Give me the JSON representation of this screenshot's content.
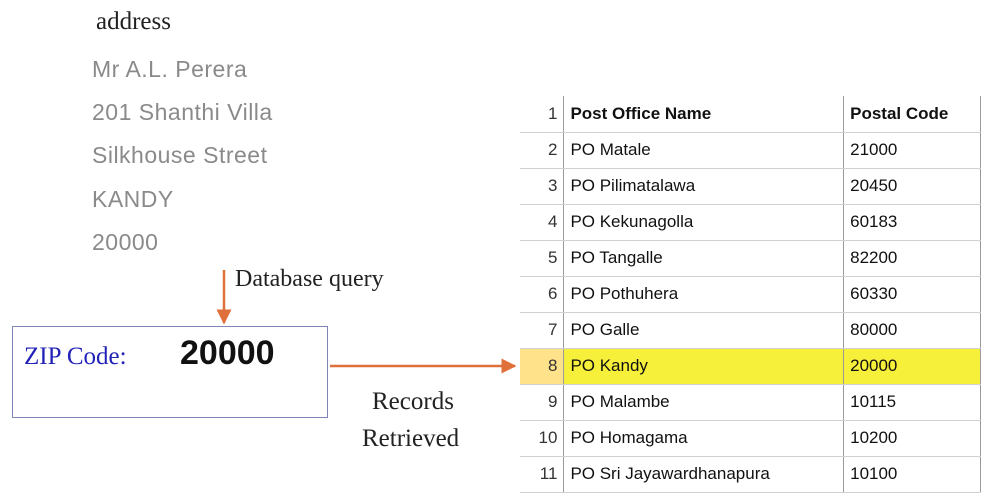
{
  "address": {
    "heading": "address",
    "lines": [
      "Mr A.L. Perera",
      "201 Shanthi Villa",
      "Silkhouse Street",
      "KANDY",
      "20000"
    ]
  },
  "query_label": "Database query",
  "zip": {
    "label": "ZIP Code:",
    "value": "20000"
  },
  "records_label": [
    "Records",
    "Retrieved"
  ],
  "table": {
    "rows": [
      {
        "num": "1",
        "name": "Post Office Name",
        "code": "Postal Code"
      },
      {
        "num": "2",
        "name": "PO Matale",
        "code": "21000"
      },
      {
        "num": "3",
        "name": "PO Pilimatalawa",
        "code": "20450"
      },
      {
        "num": "4",
        "name": "PO Kekunagolla",
        "code": "60183"
      },
      {
        "num": "5",
        "name": "PO Tangalle",
        "code": "82200"
      },
      {
        "num": "6",
        "name": "PO Pothuhera",
        "code": "60330"
      },
      {
        "num": "7",
        "name": "PO Galle",
        "code": "80000"
      },
      {
        "num": "8",
        "name": "PO Kandy",
        "code": "20000"
      },
      {
        "num": "9",
        "name": "PO Malambe",
        "code": "10115"
      },
      {
        "num": "10",
        "name": "PO Homagama",
        "code": "10200"
      },
      {
        "num": "11",
        "name": "PO Sri Jayawardhanapura",
        "code": "10100"
      }
    ],
    "highlight_color": "#f7f03a"
  },
  "colors": {
    "arrow": "#e0703a",
    "zip_label": "#2323b8",
    "box_border": "#7f86b6"
  }
}
